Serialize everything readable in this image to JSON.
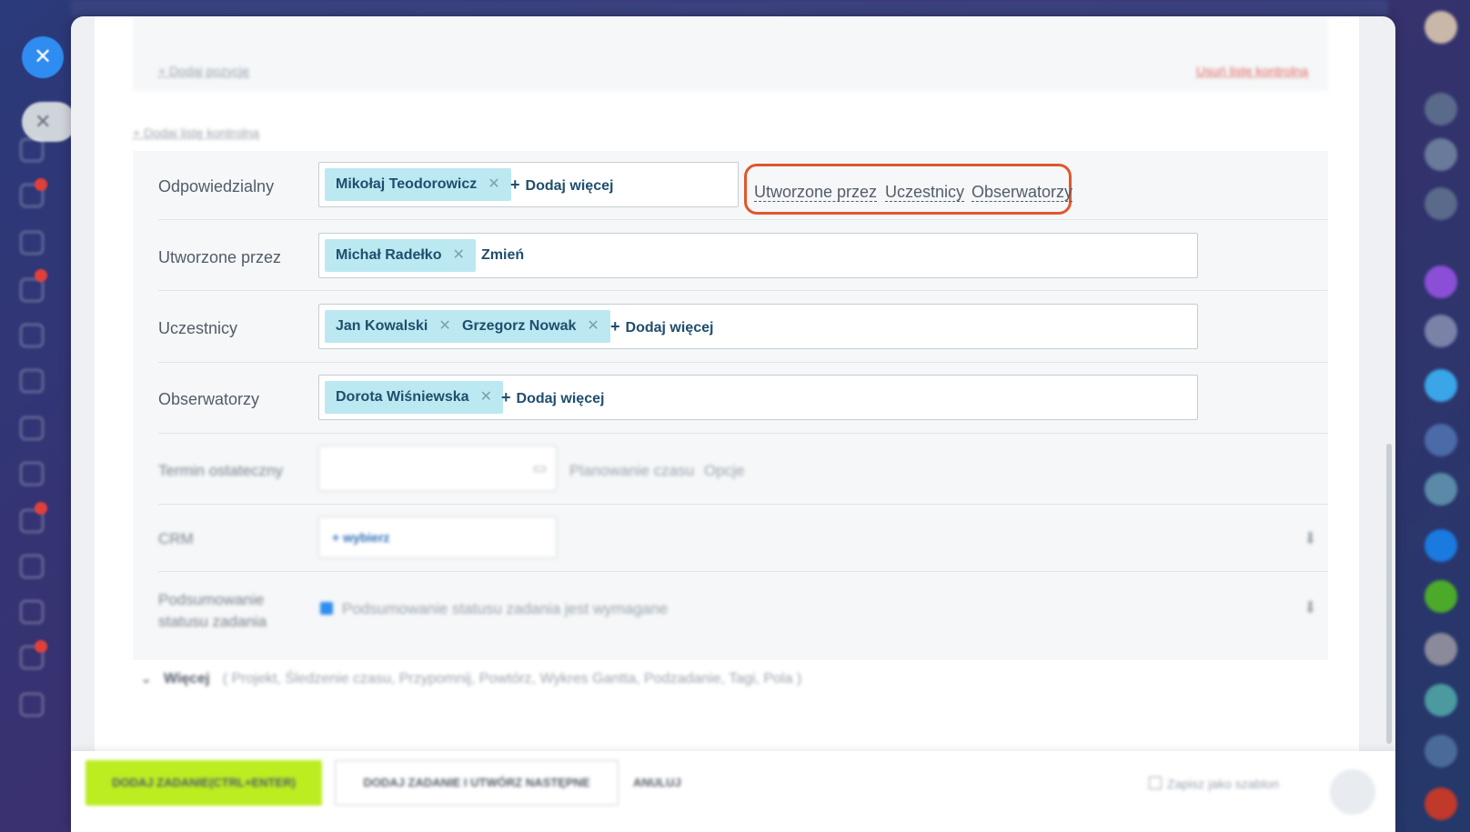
{
  "checklist": {
    "add_position": "+ Dodaj pozycję",
    "delete_list": "Usuń listę kontrolną",
    "add_checklist": "+ Dodaj listę kontrolną"
  },
  "responsible": {
    "label": "Odpowiedzialny",
    "chips": [
      "Mikołaj Teodorowicz"
    ],
    "add_more": "Dodaj więcej"
  },
  "role_links": [
    "Utworzone przez",
    "Uczestnicy",
    "Obserwatorzy"
  ],
  "created_by": {
    "label": "Utworzone przez",
    "chips": [
      "Michał Radełko"
    ],
    "change": "Zmień"
  },
  "participants": {
    "label": "Uczestnicy",
    "chips": [
      "Jan Kowalski",
      "Grzegorz Nowak"
    ],
    "add_more": "Dodaj więcej"
  },
  "observers": {
    "label": "Obserwatorzy",
    "chips": [
      "Dorota Wiśniewska"
    ],
    "add_more": "Dodaj więcej"
  },
  "deadline": {
    "label": "Termin ostateczny",
    "planning": "Planowanie czasu",
    "options": "Opcje"
  },
  "crm": {
    "label": "CRM",
    "select": "+ wybierz"
  },
  "summary": {
    "label_line1": "Podsumowanie",
    "label_line2": "statusu zadania",
    "checkbox_label": "Podsumowanie statusu zadania jest wymagane"
  },
  "more": {
    "label": "Więcej",
    "items": "( Projekt, Śledzenie czasu, Przypomnij, Powtórz, Wykres Gantta, Podzadanie, Tagi, Pola )"
  },
  "footer": {
    "add_task": "DODAJ ZADANIE(CTRL+ENTER)",
    "add_and_next": "DODAJ ZADANIE I UTWÓRZ NASTĘPNE",
    "cancel": "ANULUJ",
    "save_template": "Zapisz jako szablon"
  },
  "colors": {
    "highlight": "#e0572a",
    "chip": "#bce8f1",
    "primary_button": "#bbed21"
  }
}
